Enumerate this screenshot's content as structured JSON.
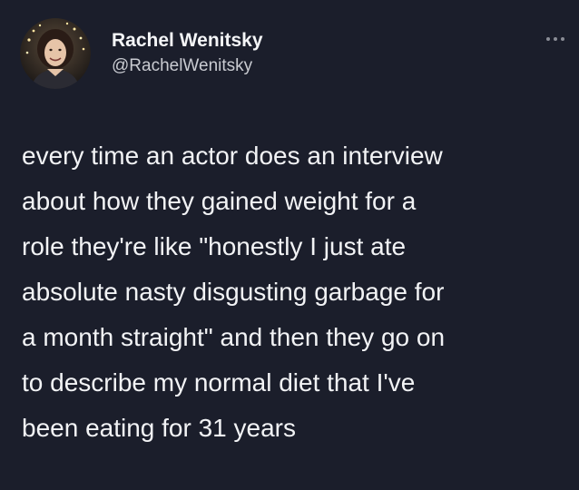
{
  "tweet": {
    "author": {
      "display_name": "Rachel Wenitsky",
      "handle": "@RachelWenitsky",
      "avatar_icon": "profile-photo"
    },
    "more_icon": "ellipsis-icon",
    "text_lines": [
      "every time an actor does an interview",
      "about how they gained weight for a",
      "role they're like \"honestly I just ate",
      "absolute nasty disgusting garbage for",
      "a month straight\" and then they go on",
      "to describe my normal diet that I've",
      "been eating for 31 years"
    ]
  },
  "colors": {
    "background": "#1b1e2b",
    "text": "#f2f3f5",
    "secondary_text": "#c9cbd1",
    "icon": "#8a8d96"
  }
}
